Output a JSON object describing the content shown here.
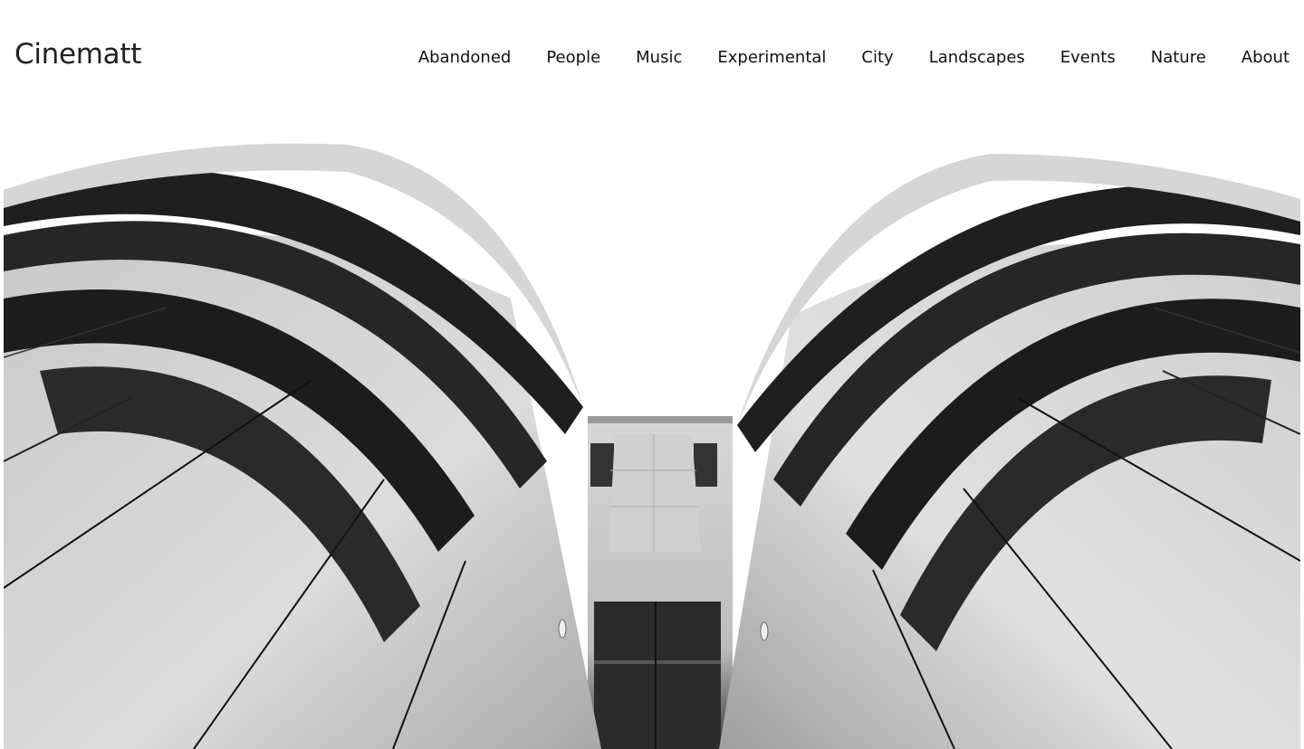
{
  "site": {
    "logo": "Cinematt"
  },
  "nav": {
    "items": [
      {
        "label": "Abandoned"
      },
      {
        "label": "People"
      },
      {
        "label": "Music"
      },
      {
        "label": "Experimental"
      },
      {
        "label": "City"
      },
      {
        "label": "Landscapes"
      },
      {
        "label": "Events"
      },
      {
        "label": "Nature"
      },
      {
        "label": "About"
      }
    ]
  },
  "colors": {
    "background": "#ffffff",
    "text": "#111111"
  }
}
